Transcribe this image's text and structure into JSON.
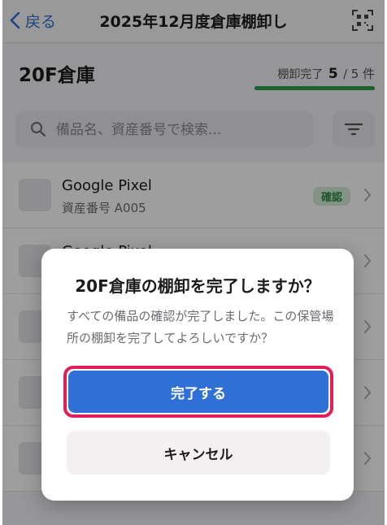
{
  "nav": {
    "back_label": "戻る",
    "title": "2025年12月度倉庫棚卸し",
    "qr_icon": "qr-scan-icon"
  },
  "location": {
    "title": "20F倉庫",
    "progress_label": "棚卸完了",
    "done": "5",
    "separator": "/",
    "total": "5 件",
    "progress_fraction": 1.0,
    "progress_color": "#2e9f4a"
  },
  "search": {
    "placeholder": "備品名、資産番号で検索...",
    "value": ""
  },
  "list": {
    "items": [
      {
        "name": "Google Pixel",
        "asset": "資産番号 A005",
        "status": "確認"
      },
      {
        "name": "Google Pixel",
        "asset": "",
        "status": ""
      },
      {
        "name": "",
        "asset": "",
        "status": ""
      },
      {
        "name": "",
        "asset": "",
        "status": ""
      },
      {
        "name": "",
        "asset": "",
        "status": ""
      }
    ]
  },
  "dialog": {
    "title": "20F倉庫の棚卸を完了しますか？",
    "message": "すべての備品の確認が完了しました。この保管場所の棚卸を完了してよろしいですか？",
    "confirm_label": "完了する",
    "cancel_label": "キャンセル",
    "confirm_color": "#2f6fd6",
    "highlight_color": "#e11d5b"
  }
}
